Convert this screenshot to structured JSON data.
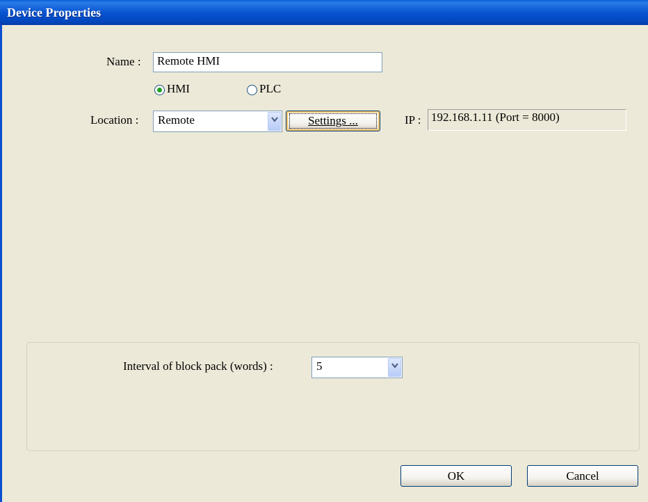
{
  "window": {
    "title": "Device Properties"
  },
  "name_field": {
    "label": "Name :",
    "value": "Remote HMI"
  },
  "device_type": {
    "hmi_label": "HMI",
    "plc_label": "PLC",
    "selected": "HMI"
  },
  "location": {
    "label": "Location :",
    "value": "Remote",
    "settings_label": "Settings ..."
  },
  "ip": {
    "label": "IP :",
    "value": "192.168.1.11 (Port = 8000)"
  },
  "block_pack": {
    "label": "Interval of block pack (words) :",
    "value": "5"
  },
  "buttons": {
    "ok": "OK",
    "cancel": "Cancel"
  },
  "colors": {
    "titlebar": "#0854d0",
    "dialog_bg": "#ece9d8",
    "radio_selected": "#21a121"
  }
}
